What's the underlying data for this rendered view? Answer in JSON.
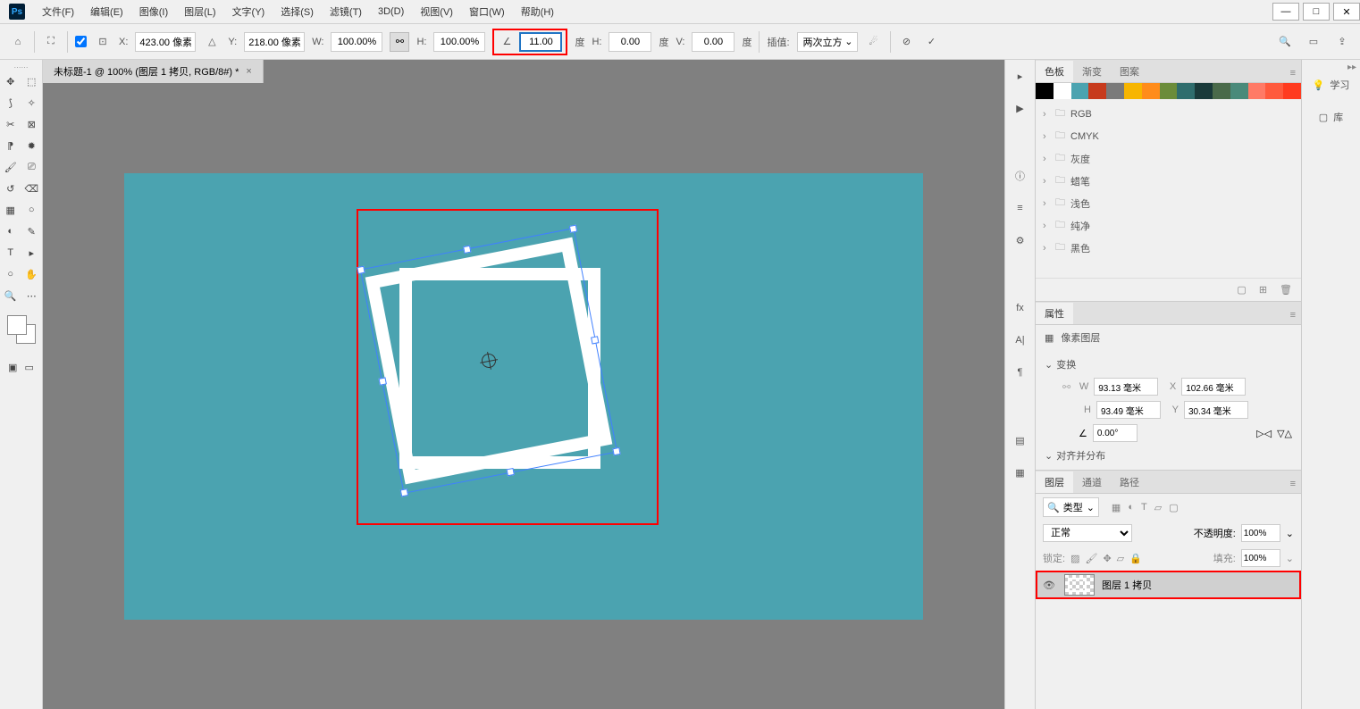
{
  "menu": {
    "file": "文件(F)",
    "edit": "编辑(E)",
    "image": "图像(I)",
    "layer": "图层(L)",
    "text": "文字(Y)",
    "select": "选择(S)",
    "filter": "滤镜(T)",
    "threed": "3D(D)",
    "view": "视图(V)",
    "window": "窗口(W)",
    "help": "帮助(H)"
  },
  "options": {
    "x_label": "X:",
    "x_value": "423.00 像素",
    "y_label": "Y:",
    "y_value": "218.00 像素",
    "w_label": "W:",
    "w_value": "100.00%",
    "h_label": "H:",
    "h_value": "100.00%",
    "rotate_value": "11.00",
    "rotate_unit": "度",
    "hskew_label": "H:",
    "hskew_value": "0.00",
    "hskew_unit": "度",
    "vskew_label": "V:",
    "vskew_value": "0.00",
    "vskew_unit": "度",
    "interp_label": "插值:",
    "interp_value": "两次立方"
  },
  "doc": {
    "tab_title": "未标题-1 @ 100% (图层 1 拷贝, RGB/8#) *"
  },
  "swatches": {
    "tabs": {
      "color": "色板",
      "gradient": "渐变",
      "pattern": "图案"
    },
    "colors": [
      "#000000",
      "#ffffff",
      "#4ba3b0",
      "#c73b1d",
      "#7a7a7a",
      "#f7b500",
      "#ff8c1a",
      "#6b8c3a",
      "#2f6d6d",
      "#1a3a3a",
      "#4a6a4a",
      "#4a8a7a",
      "#ff7a66",
      "#ff5a3d",
      "#ff3b1f"
    ],
    "folders": [
      "RGB",
      "CMYK",
      "灰度",
      "蜡笔",
      "浅色",
      "纯净",
      "黑色"
    ]
  },
  "props": {
    "tab": "属性",
    "header": "像素图层",
    "transform": "变换",
    "w_label": "W",
    "w_val": "93.13 毫米",
    "x_label": "X",
    "x_val": "102.66 毫米",
    "h_label": "H",
    "h_val": "93.49 毫米",
    "y_label": "Y",
    "y_val": "30.34 毫米",
    "angle_val": "0.00°",
    "align": "对齐并分布"
  },
  "layers": {
    "tabs": {
      "layers": "图层",
      "channels": "通道",
      "paths": "路径"
    },
    "filter_label": "类型",
    "blend": "正常",
    "opacity_label": "不透明度:",
    "opacity_val": "100%",
    "lock_label": "锁定:",
    "fill_label": "填充:",
    "fill_val": "100%",
    "layer_name": "图层 1 拷贝"
  },
  "far_right": {
    "learn": "学习",
    "library": "库"
  }
}
